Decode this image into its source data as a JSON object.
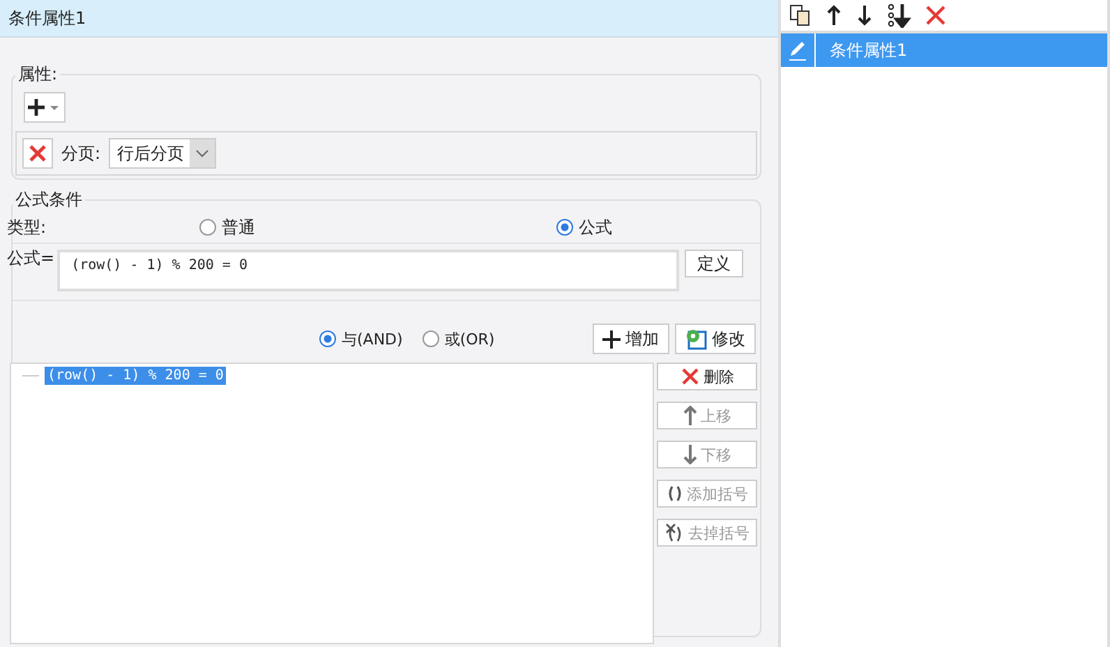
{
  "title": "条件属性1",
  "properties": {
    "label": "属性:",
    "pagination": {
      "label": "分页:",
      "value": "行后分页"
    }
  },
  "formula_condition": {
    "title": "公式条件",
    "type_label": "类型:",
    "types": [
      {
        "label": "普通",
        "selected": false
      },
      {
        "label": "公式",
        "selected": true
      }
    ],
    "formula_label": "公式=",
    "formula_value": "(row() - 1) % 200 = 0",
    "define_button": "定义",
    "logic": [
      {
        "label": "与(AND)",
        "selected": true
      },
      {
        "label": "或(OR)",
        "selected": false
      }
    ],
    "add_button": "增加",
    "modify_button": "修改",
    "conditions": [
      {
        "text": "(row() - 1) % 200 = 0",
        "selected": true
      }
    ],
    "actions": [
      {
        "kind": "delete",
        "label": "删除",
        "disabled": false
      },
      {
        "kind": "up",
        "label": "上移",
        "disabled": true
      },
      {
        "kind": "down",
        "label": "下移",
        "disabled": true
      },
      {
        "kind": "add-bracket",
        "label": "添加括号",
        "disabled": true
      },
      {
        "kind": "remove-bracket",
        "label": "去掉括号",
        "disabled": true
      }
    ]
  },
  "side": {
    "items": [
      {
        "label": "条件属性1",
        "selected": true
      }
    ]
  }
}
